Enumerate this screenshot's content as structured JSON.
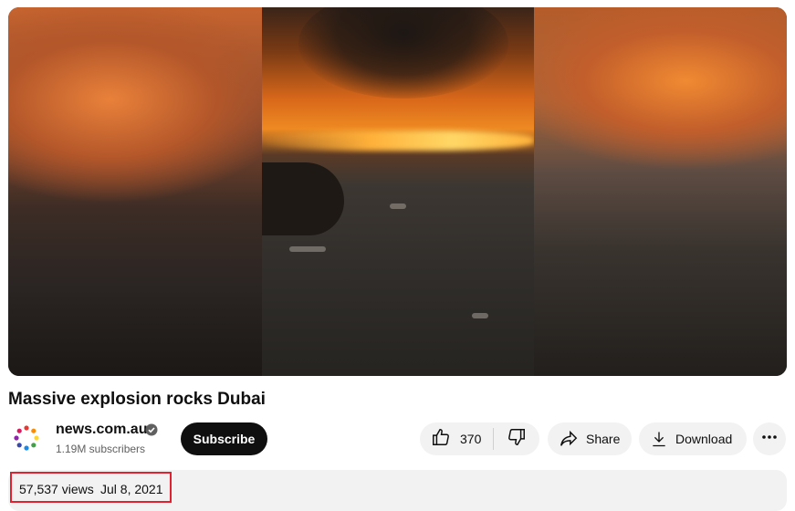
{
  "video": {
    "title": "Massive explosion rocks Dubai"
  },
  "channel": {
    "name": "news.com.au",
    "subscribers": "1.19M subscribers",
    "subscribe_label": "Subscribe"
  },
  "actions": {
    "like_count": "370",
    "share_label": "Share",
    "download_label": "Download"
  },
  "description": {
    "views": "57,537 views",
    "date": "Jul 8, 2021"
  },
  "icons": [
    "channel-avatar-icon",
    "verified-icon",
    "thumbs-up-icon",
    "thumbs-down-icon",
    "share-arrow-icon",
    "download-icon",
    "more-options-icon"
  ],
  "colors": {
    "subscribe_bg": "#0f0f0f",
    "pill_bg": "#f2f2f2",
    "highlight_border": "#e3202f"
  }
}
